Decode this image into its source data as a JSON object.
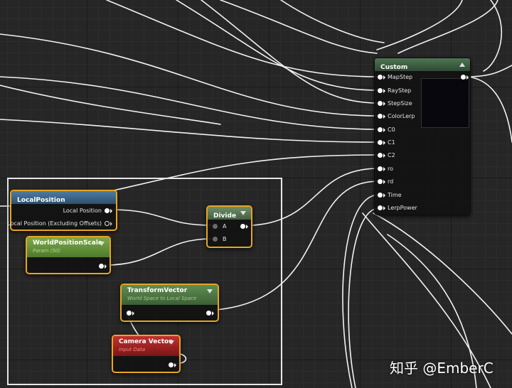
{
  "colors": {
    "wire": "#ffffff",
    "selection": "#e8a521",
    "vector_header": "#3f6c93",
    "scalar_header": "#68963a",
    "transform_header": "#4d7b42",
    "camera_header": "#a12121",
    "divide_header": "#516e4e",
    "custom_header": "#3e5f43"
  },
  "custom": {
    "title": "Custom",
    "inputs": [
      "MapStep",
      "RayStep",
      "StepSize",
      "ColorLerp",
      "C0",
      "C1",
      "C2",
      "ro",
      "rd",
      "Time",
      "LerpPower"
    ]
  },
  "local_position": {
    "title": "LocalPosition",
    "outputs": [
      "Local Position",
      "Local Position (Excluding Offsets)"
    ]
  },
  "world_position_scale": {
    "title": "WorldPositionScale",
    "subtitle": "Param (50)"
  },
  "divide": {
    "title": "Divide",
    "inputs": [
      "A",
      "B"
    ]
  },
  "transform_vector": {
    "title": "TransformVector",
    "subtitle": "World Space to Local Space"
  },
  "camera_vector": {
    "title": "Camera Vector",
    "subtitle": "Input Data"
  },
  "watermark": "知乎 @EmberC"
}
